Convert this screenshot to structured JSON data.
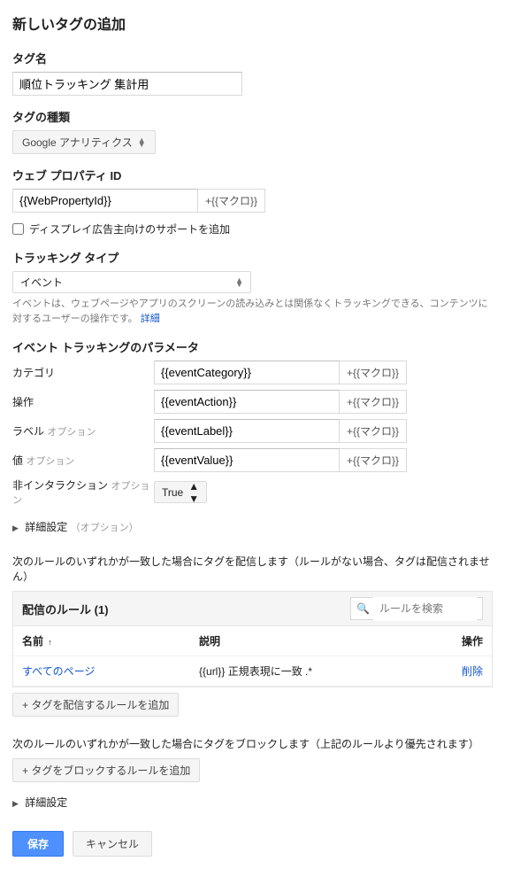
{
  "page_title": "新しいタグの追加",
  "tag_name": {
    "label": "タグ名",
    "value": "順位トラッキング 集計用"
  },
  "tag_type": {
    "label": "タグの種類",
    "value": "Google アナリティクス"
  },
  "web_property": {
    "label": "ウェブ プロパティ ID",
    "value": "{{WebPropertyId}}",
    "macro": "+{{マクロ}}"
  },
  "display_ads": {
    "label": "ディスプレイ広告主向けのサポートを追加"
  },
  "tracking_type": {
    "label": "トラッキング タイプ",
    "value": "イベント",
    "help_text": "イベントは、ウェブページやアプリのスクリーンの読み込みとは関係なくトラッキングできる、コンテンツに対するユーザーの操作です。",
    "help_link": "詳細"
  },
  "event_params": {
    "header": "イベント トラッキングのパラメータ",
    "macro": "+{{マクロ}}",
    "rows": [
      {
        "label": "カテゴリ",
        "opt": "",
        "value": "{{eventCategory}}"
      },
      {
        "label": "操作",
        "opt": "",
        "value": "{{eventAction}}"
      },
      {
        "label": "ラベル",
        "opt": "オプション",
        "value": "{{eventLabel}}"
      },
      {
        "label": "値",
        "opt": "オプション",
        "value": "{{eventValue}}"
      }
    ],
    "non_interaction": {
      "label": "非インタラクション",
      "opt": "オプション",
      "value": "True"
    }
  },
  "advanced1": {
    "label": "詳細設定",
    "opt": "（オプション）"
  },
  "deliver": {
    "intro": "次のルールのいずれかが一致した場合にタグを配信します（ルールがない場合、タグは配信されません）",
    "header": "配信のルール",
    "count": "(1)",
    "search_placeholder": "ルールを検索",
    "cols": {
      "name": "名前",
      "desc": "説明",
      "op": "操作"
    },
    "row": {
      "name": "すべてのページ",
      "desc": "{{url}} 正規表現に一致 .*",
      "op": "削除"
    },
    "add_btn": "+ タグを配信するルールを追加"
  },
  "block": {
    "intro": "次のルールのいずれかが一致した場合にタグをブロックします（上記のルールより優先されます）",
    "add_btn": "+ タグをブロックするルールを追加"
  },
  "advanced2": {
    "label": "詳細設定"
  },
  "actions": {
    "save": "保存",
    "cancel": "キャンセル"
  }
}
